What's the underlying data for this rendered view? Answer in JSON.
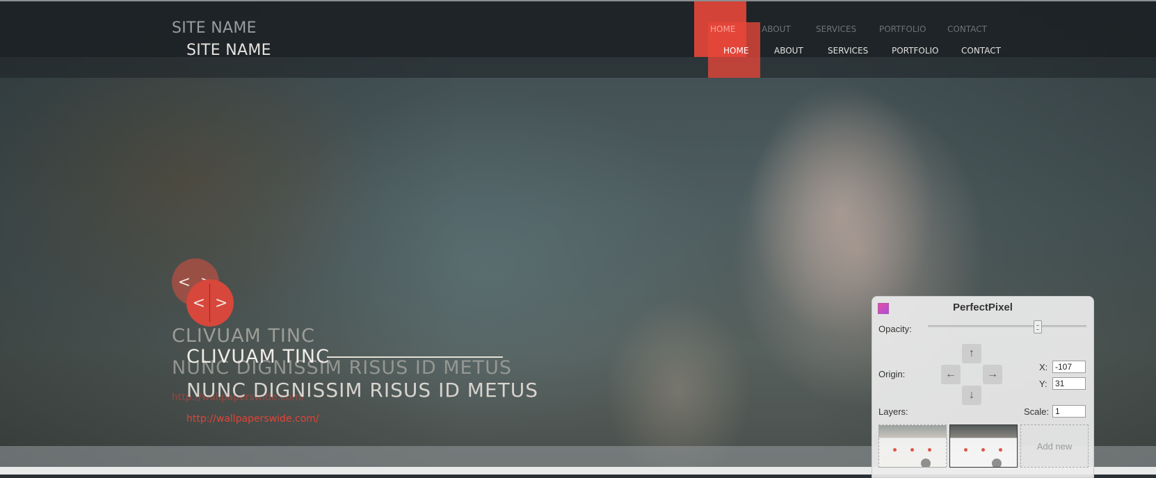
{
  "site": {
    "name": "SITE NAME",
    "nav": [
      "HOME",
      "ABOUT",
      "SERVICES",
      "PORTFOLIO",
      "CONTACT"
    ]
  },
  "slider": {
    "prev_arrow": "<",
    "next_arrow": ">",
    "title": "CLIVUAM TINC",
    "subtitle": "NUNC DIGNISSIM RISUS ID METUS",
    "link": "http://wallpaperswide.com/"
  },
  "perfectpixel": {
    "title": "PerfectPixel",
    "opacity_label": "Opacity:",
    "origin_label": "Origin:",
    "x_label": "X:",
    "y_label": "Y:",
    "x_value": "-107",
    "y_value": "31",
    "layers_label": "Layers:",
    "scale_label": "Scale:",
    "scale_value": "1",
    "add_new_label": "Add new",
    "arrows": {
      "up": "↑",
      "down": "↓",
      "left": "←",
      "right": "→"
    }
  },
  "colors": {
    "accent": "#e8473a",
    "header_bg": "#1c2125"
  }
}
